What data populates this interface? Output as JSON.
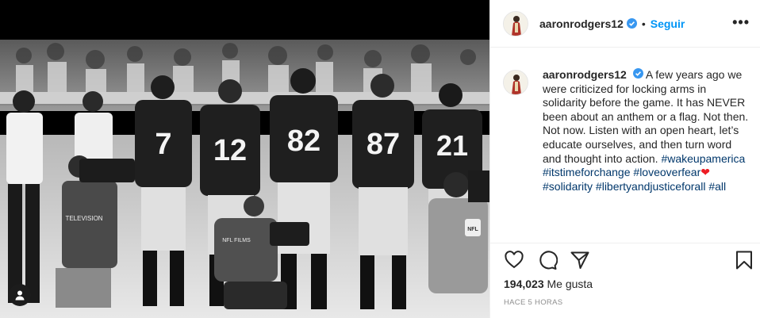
{
  "post": {
    "username": "aaronrodgers12",
    "follow_label": "Seguir",
    "separator": "•",
    "more_label": "•••",
    "caption_prefix": "A few years ago we were criticized for locking arms in solidarity before the game. It has NEVER been about an anthem or a flag. Not then. Not now. Listen with an open heart, let’s educate ourselves, and then turn word and thought into action.",
    "hashtags": [
      "#wakeupamerica",
      "#itstimeforchange",
      "#loveoverfear",
      "#solidarity",
      "#libertyandjusticeforall",
      "#all"
    ],
    "heart_emoji": "❤",
    "likes_count": "194,023",
    "likes_label": "Me gusta",
    "timestamp": "HACE 5 HORAS"
  },
  "photo": {
    "jersey_numbers": [
      "7",
      "12",
      "82",
      "87",
      "21"
    ],
    "camera_vest_text": "TELEVISION",
    "photographer_vest_text": "NFL FILMS",
    "nfl_badge": "NFL"
  },
  "colors": {
    "accent_blue": "#0095f6",
    "hashtag": "#00376b",
    "heart": "#ed1c24",
    "verified": "#3897f0",
    "muted": "#8e8e8e"
  },
  "icons": [
    "verified-badge-icon",
    "more-options-icon",
    "heart-icon",
    "comment-icon",
    "share-icon",
    "bookmark-icon",
    "user-tag-icon"
  ]
}
